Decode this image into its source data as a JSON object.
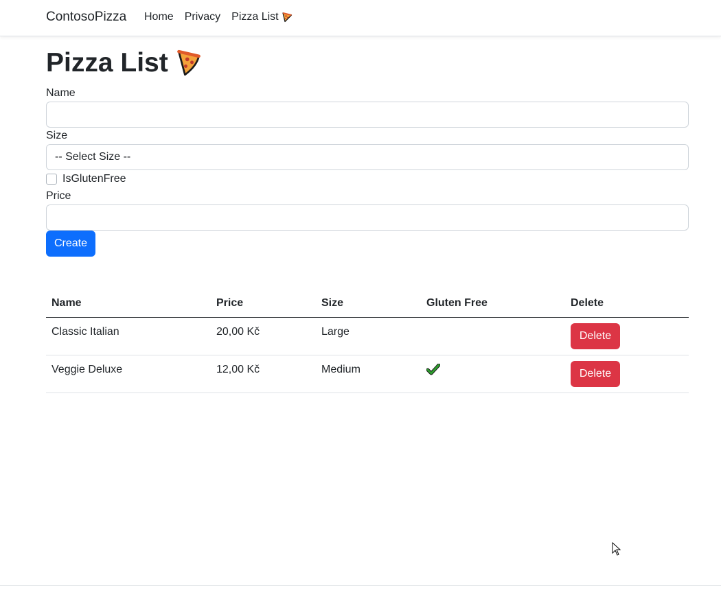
{
  "navbar": {
    "brand": "ContosoPizza",
    "links": [
      {
        "label": "Home"
      },
      {
        "label": "Privacy"
      },
      {
        "label": "Pizza List"
      }
    ],
    "pizza_icon": "pizza-slice-icon"
  },
  "page": {
    "title": "Pizza List"
  },
  "form": {
    "name_label": "Name",
    "name_value": "",
    "size_label": "Size",
    "size_selected": "-- Select Size --",
    "gluten_label": "IsGlutenFree",
    "gluten_checked": false,
    "price_label": "Price",
    "price_value": "",
    "create_label": "Create"
  },
  "table": {
    "headers": [
      "Name",
      "Price",
      "Size",
      "Gluten Free",
      "Delete"
    ],
    "rows": [
      {
        "name": "Classic Italian",
        "price": "20,00 Kč",
        "size": "Large",
        "gluten_free": false,
        "delete_label": "Delete"
      },
      {
        "name": "Veggie Deluxe",
        "price": "12,00 Kč",
        "size": "Medium",
        "gluten_free": true,
        "delete_label": "Delete"
      }
    ]
  },
  "colors": {
    "primary": "#0d6efd",
    "danger": "#dc3545",
    "check": "#2e9e2e"
  }
}
